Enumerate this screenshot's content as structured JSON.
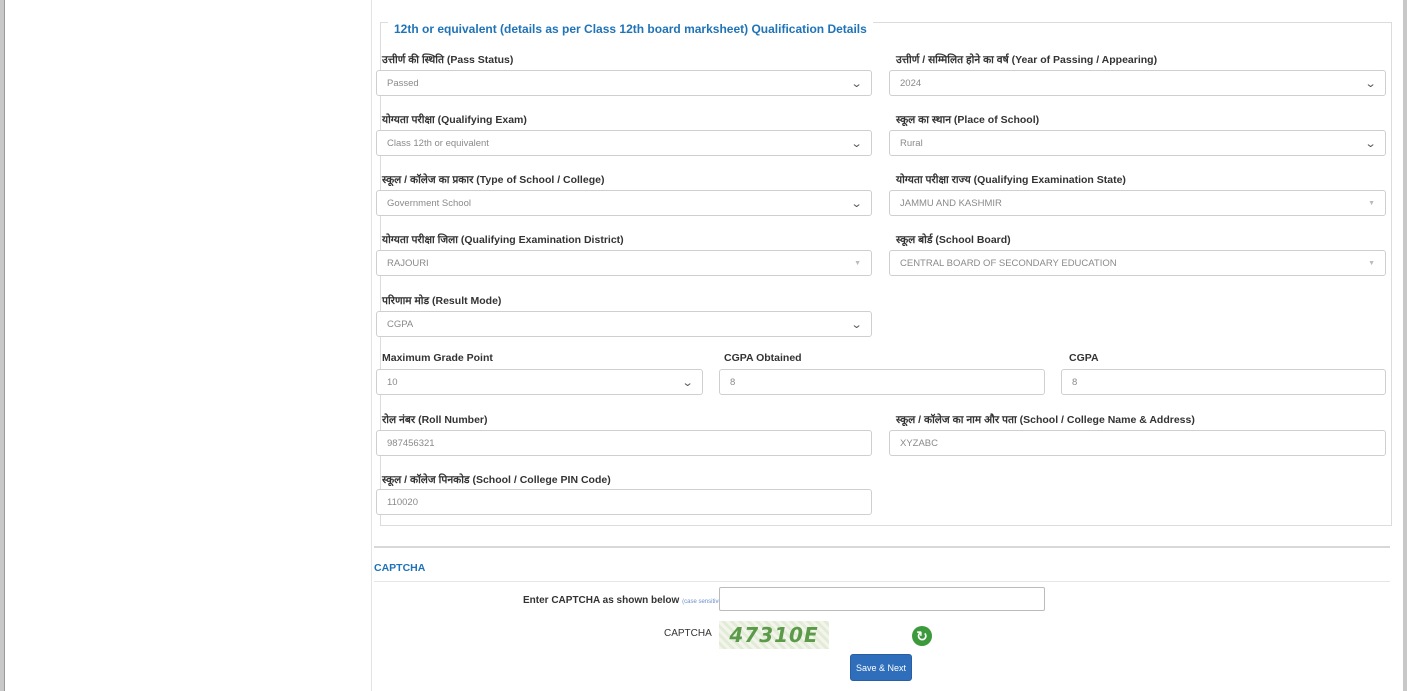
{
  "section": {
    "legend": "12th or equivalent (details as per Class 12th board marksheet) Qualification Details"
  },
  "fields": {
    "pass_status": {
      "label": "उत्तीर्ण की स्थिति (Pass Status)",
      "value": "Passed"
    },
    "year_of_passing": {
      "label": "उत्तीर्ण / सम्मिलित होने का वर्ष (Year of Passing / Appearing)",
      "value": "2024"
    },
    "qualifying_exam": {
      "label": "योग्यता परीक्षा (Qualifying Exam)",
      "value": "Class 12th or equivalent"
    },
    "place_of_school": {
      "label": "स्कूल का स्थान (Place of School)",
      "value": "Rural"
    },
    "type_of_school": {
      "label": "स्कूल / कॉलेज का प्रकार (Type of School / College)",
      "value": "Government School"
    },
    "exam_state": {
      "label": "योग्यता परीक्षा राज्य (Qualifying Examination State)",
      "value": "JAMMU AND KASHMIR"
    },
    "exam_district": {
      "label": "योग्यता परीक्षा जिला (Qualifying Examination District)",
      "value": "RAJOURI"
    },
    "school_board": {
      "label": "स्कूल बोर्ड (School Board)",
      "value": "CENTRAL BOARD OF SECONDARY EDUCATION"
    },
    "result_mode": {
      "label": "परिणाम मोड (Result Mode)",
      "value": "CGPA"
    },
    "max_grade_point": {
      "label": "Maximum Grade Point",
      "value": "10"
    },
    "cgpa_obtained": {
      "label": "CGPA Obtained",
      "value": "8"
    },
    "cgpa": {
      "label": "CGPA",
      "value": "8"
    },
    "roll_number": {
      "label": "रोल नंबर (Roll Number)",
      "value": "987456321"
    },
    "school_name_address": {
      "label": "स्कूल / कॉलेज का नाम और पता (School / College Name & Address)",
      "value": "XYZABC"
    },
    "school_pin": {
      "label": "स्कूल / कॉलेज पिनकोड (School / College PIN Code)",
      "value": "110020"
    }
  },
  "captcha": {
    "heading": "CAPTCHA",
    "enter_label": "Enter CAPTCHA as shown below",
    "case_note": "(case sensitive)",
    "captcha_label": "CAPTCHA",
    "code": "47310E",
    "input_value": ""
  },
  "actions": {
    "save_next_label": "Save & Next"
  },
  "icons": {
    "dropdown": "chevron-down-icon",
    "refresh": "refresh-icon"
  },
  "colors": {
    "accent": "#1f73b7",
    "button": "#2f6ebb",
    "captcha_text": "#5a9a48",
    "refresh": "#3c9a3c"
  }
}
